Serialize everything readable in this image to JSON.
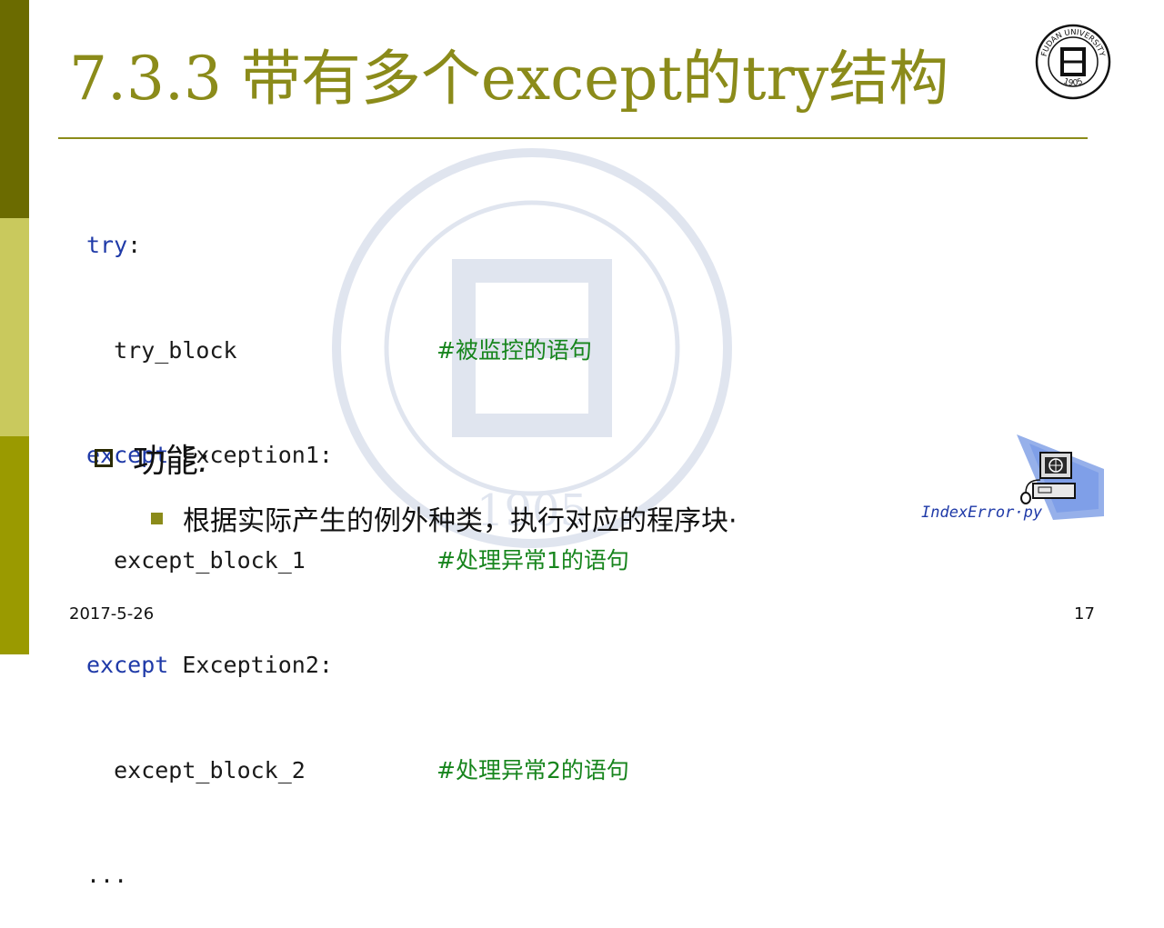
{
  "slide": {
    "title": "7.3.3 带有多个except的try结构",
    "code_lines": [
      {
        "kw": "try",
        "rest": ":",
        "comment": ""
      },
      {
        "kw": "",
        "rest": "  try_block",
        "comment": "#被监控的语句"
      },
      {
        "kw": "except",
        "rest": " Exception1:",
        "comment": ""
      },
      {
        "kw": "",
        "rest": "  except_block_1",
        "comment": "#处理异常1的语句"
      },
      {
        "kw": "except",
        "rest": " Exception2:",
        "comment": ""
      },
      {
        "kw": "",
        "rest": "  except_block_2",
        "comment": "#处理异常2的语句"
      },
      {
        "kw": "",
        "rest": "...",
        "comment": ""
      }
    ],
    "bullet_heading": "功能",
    "bullet_heading_colon": ":",
    "sub_bullet": "根据实际产生的例外种类，执行对应的程序块·",
    "file_link": "IndexError·py",
    "footer_date": "2017-5-26",
    "page_number": "17",
    "logo_text": "FUDAN UNIVERSITY",
    "logo_year": "1905",
    "watermark_year": "1905"
  },
  "colors": {
    "accent": "#8b8b1a",
    "keyword": "#1f3aa8",
    "comment": "#17851d",
    "bar_dark": "#6b6b00",
    "bar_light": "#c9c95d",
    "bar_mid": "#9a9a00"
  },
  "icons": {
    "logo": "fudan-university-seal-icon",
    "computer": "computer-globe-icon"
  }
}
